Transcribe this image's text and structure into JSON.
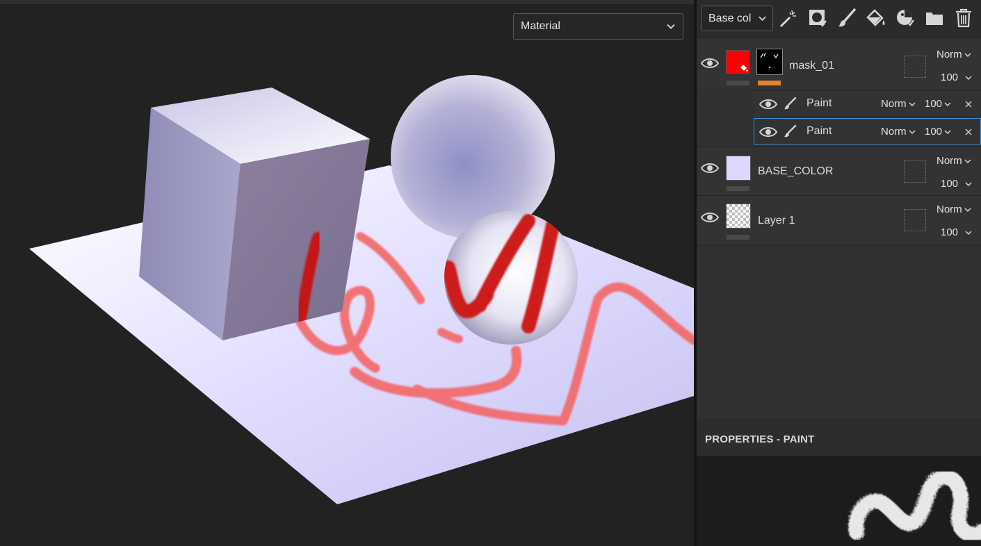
{
  "viewport": {
    "view_mode": "Material"
  },
  "toolbar": {
    "channel": "Base col",
    "tools": [
      "magic-wand-icon",
      "mask-icon",
      "brush-icon",
      "fill-bucket-icon",
      "smart-material-icon",
      "folder-icon",
      "trash-icon"
    ]
  },
  "layers": {
    "mask_layer": {
      "name": "mask_01",
      "color": "#ff0000",
      "blend": "Norm",
      "opacity": "100",
      "accent": "#e8822a",
      "sublayers": [
        {
          "name": "Paint",
          "blend": "Norm",
          "opacity": "100"
        },
        {
          "name": "Paint",
          "blend": "Norm",
          "opacity": "100"
        }
      ]
    },
    "base_layer": {
      "name": "BASE_COLOR",
      "color": "#dcd8ff",
      "blend": "Norm",
      "opacity": "100"
    },
    "layer1": {
      "name": "Layer 1",
      "blend": "Norm",
      "opacity": "100"
    }
  },
  "properties": {
    "title": "PROPERTIES - PAINT"
  }
}
